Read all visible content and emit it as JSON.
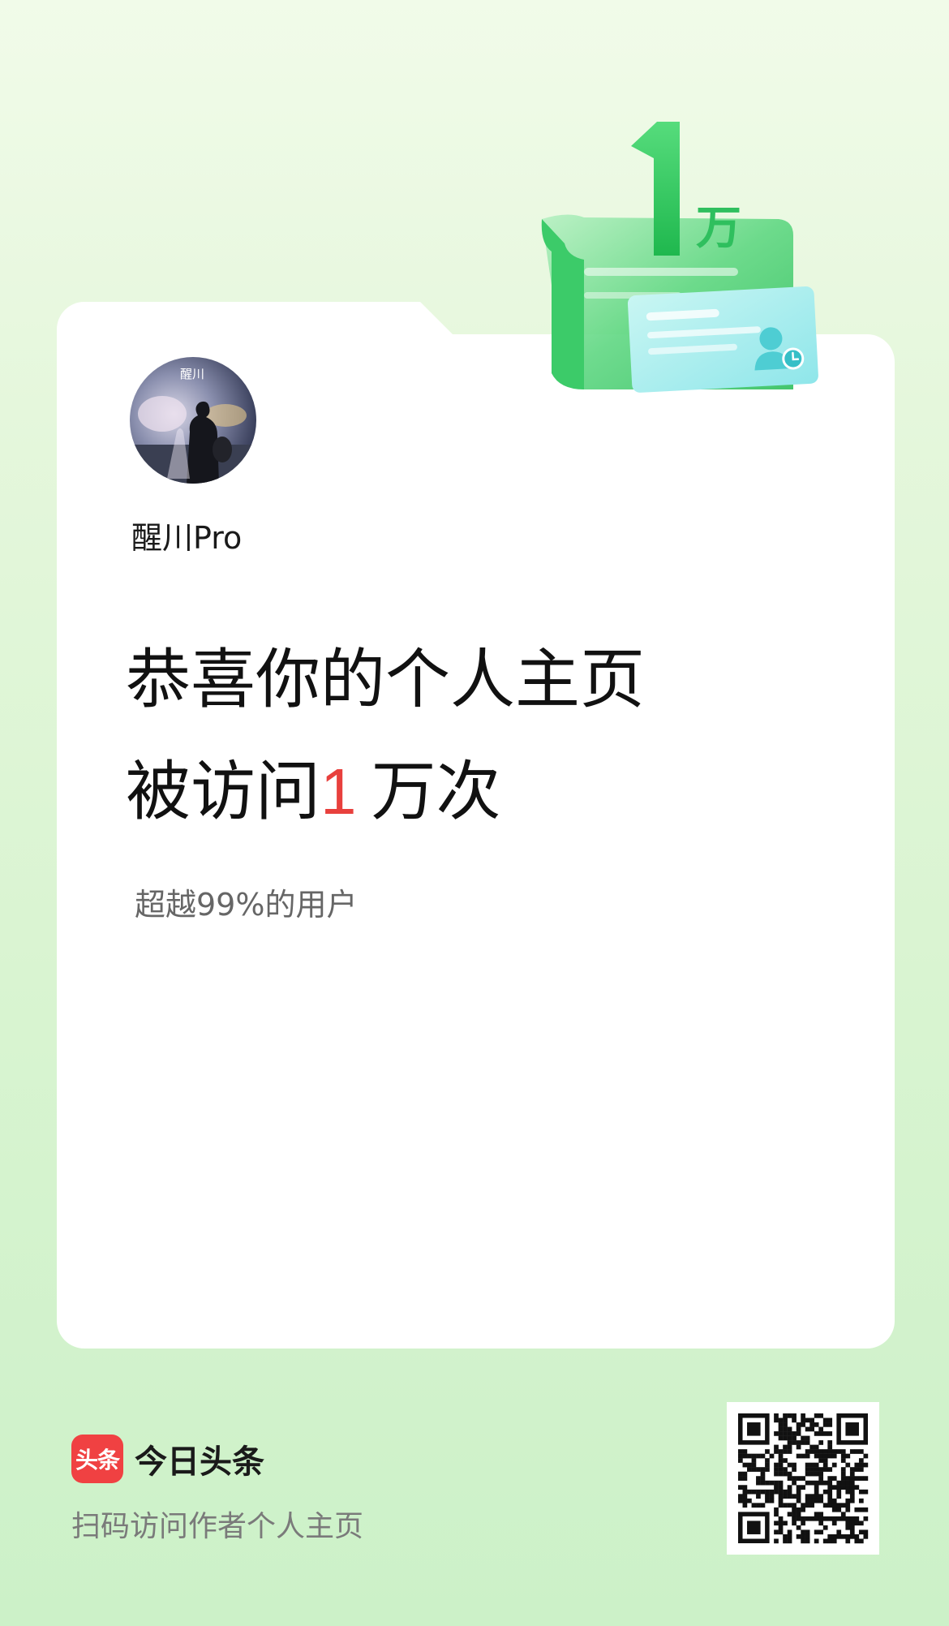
{
  "profile": {
    "avatar_text": "醒川",
    "username": "醒川Pro"
  },
  "badge": {
    "number": "1",
    "unit": "万"
  },
  "headline": {
    "line1": "恭喜你的个人主页",
    "line2_prefix": "被访问",
    "line2_number": "1",
    "line2_suffix": "万次"
  },
  "subtext": "超越99%的用户",
  "footer": {
    "logo_mark": "头条",
    "app_name": "今日头条",
    "hint": "扫码访问作者个人主页"
  },
  "colors": {
    "accent_red": "#e8403d",
    "brand_red": "#f04142",
    "green": "#3fcf6a"
  },
  "icons": {
    "badge": "visit-milestone-illustration-icon",
    "profile": "user-clock-icon",
    "qr": "qr-code-icon"
  }
}
